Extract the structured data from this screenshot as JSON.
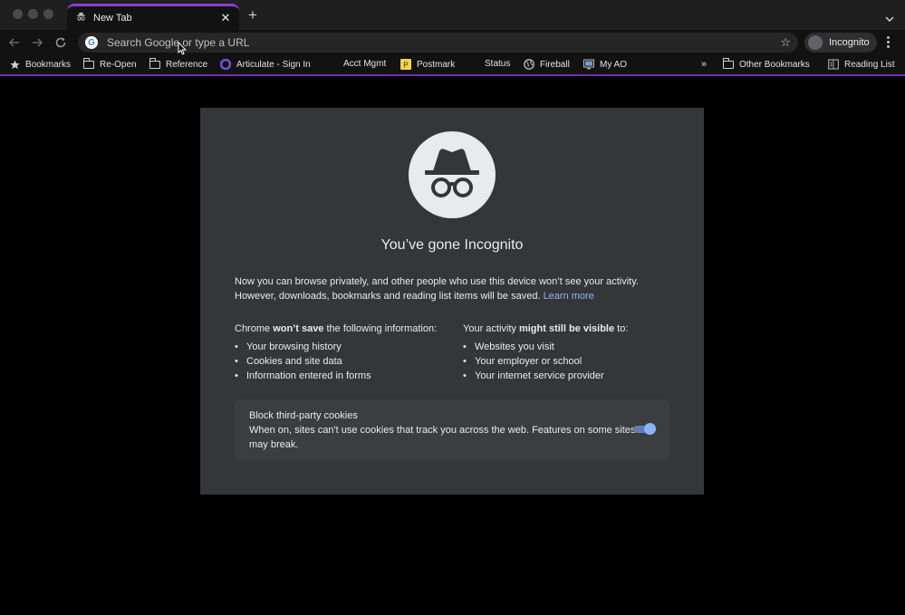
{
  "tab": {
    "title": "New Tab"
  },
  "omnibox": {
    "placeholder": "Search Google or type a URL",
    "search_engine_icon": "G"
  },
  "profile": {
    "label": "Incognito"
  },
  "bookmarks": {
    "items": [
      {
        "label": "Bookmarks",
        "icon": "star-icon"
      },
      {
        "label": "Re-Open",
        "icon": "folder-icon"
      },
      {
        "label": "Reference",
        "icon": "folder-icon"
      },
      {
        "label": "Articulate - Sign In",
        "icon": "articulate-icon"
      },
      {
        "label": "Acct Mgmt",
        "icon": "none"
      },
      {
        "label": "Postmark",
        "icon": "postmark-icon"
      },
      {
        "label": "Status",
        "icon": "none"
      },
      {
        "label": "Fireball",
        "icon": "globe-icon"
      },
      {
        "label": "My AO",
        "icon": "monitor-icon"
      }
    ],
    "overflow": "»",
    "other": "Other Bookmarks",
    "reading_list": "Reading List"
  },
  "incognito": {
    "headline": "You’ve gone Incognito",
    "intro_line1": "Now you can browse privately, and other people who use this device won’t see your activity.",
    "intro_line2": "However, downloads, bookmarks and reading list items will be saved.",
    "learn_more": "Learn more",
    "left_heading_pre": "Chrome ",
    "left_heading_bold": "won’t save",
    "left_heading_post": " the following information:",
    "left_items": [
      "Your browsing history",
      "Cookies and site data",
      "Information entered in forms"
    ],
    "right_heading_pre": "Your activity ",
    "right_heading_bold": "might still be visible",
    "right_heading_post": " to:",
    "right_items": [
      "Websites you visit",
      "Your employer or school",
      "Your internet service provider"
    ],
    "cookies_title": "Block third-party cookies",
    "cookies_desc": "When on, sites can't use cookies that track you across the web. Features on some sites may break.",
    "cookies_enabled": true
  },
  "colors": {
    "accent": "#8b3fd1",
    "card": "#35363a",
    "link": "#8ab4f8",
    "toggle": "#8ab4f8"
  }
}
